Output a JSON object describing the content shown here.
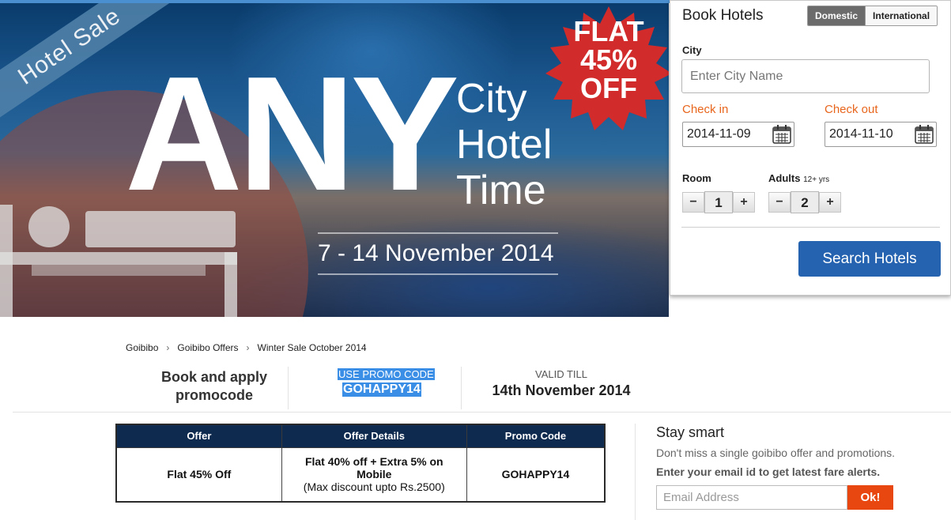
{
  "banner": {
    "ribbon_text": "Hotel Sale",
    "headline": "ANY",
    "city_lines": [
      "City",
      "Hotel",
      "Time"
    ],
    "dates": "7 - 14 November 2014",
    "flat_line": "FLAT",
    "percent_line": "45%",
    "off_line": "OFF"
  },
  "booking": {
    "title": "Book Hotels",
    "tabs": [
      {
        "label": "Domestic",
        "active": true
      },
      {
        "label": "International",
        "active": false
      }
    ],
    "city_label": "City",
    "city_placeholder": "Enter City Name",
    "checkin_label": "Check in",
    "checkin_value": "2014-11-09",
    "checkout_label": "Check out",
    "checkout_value": "2014-11-10",
    "room_label": "Room",
    "room_value": "1",
    "adults_label": "Adults",
    "adults_hint": "12+ yrs",
    "adults_value": "2",
    "minus_label": "−",
    "plus_label": "+",
    "search_label": "Search Hotels"
  },
  "breadcrumb": {
    "items": [
      "Goibibo",
      "Goibibo Offers",
      "Winter Sale October 2014"
    ],
    "separator": "›"
  },
  "promo_strip": {
    "left_text_1": "Book and apply",
    "left_text_2": "promocode",
    "code_label": "USE PROMO CODE",
    "code": "GOHAPPY14",
    "valid_label": "VALID TILL",
    "valid_date": "14th November 2014"
  },
  "offer_table": {
    "headers": [
      "Offer",
      "Offer Details",
      "Promo Code"
    ],
    "rows": [
      {
        "offer": "Flat 45% Off",
        "details_line1": "Flat 40% off + Extra 5% on",
        "details_line2": "Mobile",
        "details_line3": "(Max discount upto Rs.2500)",
        "code": "GOHAPPY14"
      }
    ]
  },
  "stay_smart": {
    "title": "Stay smart",
    "subtitle": "Don't miss a single goibibo offer and promotions.",
    "cta_text": "Enter your email id to get latest fare alerts.",
    "email_placeholder": "Email Address",
    "button_label": "Ok!"
  },
  "colors": {
    "primary_button": "#2563b0",
    "accent_orange": "#e8651c",
    "ok_button": "#e8470f",
    "table_header": "#0e2a4f",
    "burst_red": "#d12b2b"
  }
}
